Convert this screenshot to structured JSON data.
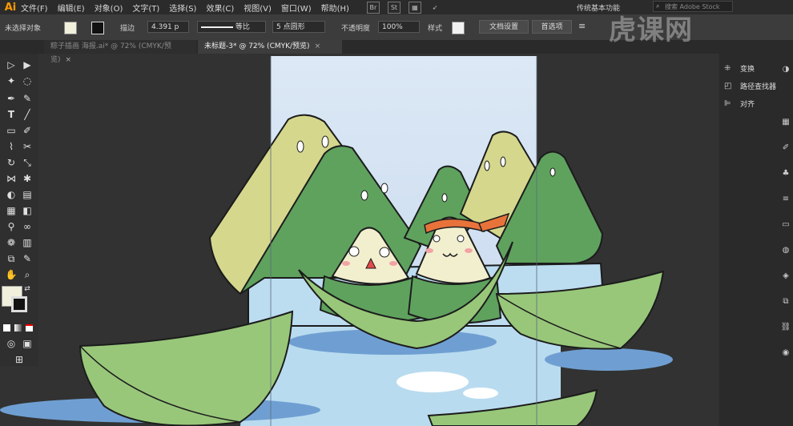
{
  "app": {
    "logo": "Ai"
  },
  "menus": [
    "文件(F)",
    "编辑(E)",
    "对象(O)",
    "文字(T)",
    "选择(S)",
    "效果(C)",
    "视图(V)",
    "窗口(W)",
    "帮助(H)"
  ],
  "menubar_icons": [
    "Br",
    "St"
  ],
  "workspace": {
    "label": "传统基本功能"
  },
  "stock_search": {
    "placeholder": "搜索 Adobe Stock"
  },
  "control_bar": {
    "no_selection": "未选择对象",
    "stroke_label": "描边",
    "stroke_value": "4.391",
    "stroke_unit": "p",
    "profile_label": "等比",
    "brush_value": "5 点圆形",
    "opacity_label": "不透明度",
    "opacity_value": "100%",
    "style_label": "样式",
    "doc_setup_button": "文档设置",
    "preferences_button": "首选项"
  },
  "tabs": [
    {
      "label": "粽子插画 海报.ai* @ 72% (CMYK/预览)",
      "active": false
    },
    {
      "label": "未标题-3* @ 72% (CMYK/预览)",
      "active": true
    }
  ],
  "tab_close": "×",
  "right_panel": {
    "items": [
      {
        "icon": "transform-icon",
        "label": "变换"
      },
      {
        "icon": "pathfinder-icon",
        "label": "路径查找器"
      },
      {
        "icon": "align-icon",
        "label": "对齐"
      }
    ]
  },
  "watermark": {
    "text": "虎课网"
  },
  "colors": {
    "app_bg": "#323232",
    "sky": "#c5d8ee",
    "water": "#b9dbef",
    "water_shadow": "#6f9fd2",
    "leaf": "#98c77a",
    "mountain_dark": "#5fa25e",
    "mountain_light": "#d5d78d",
    "zongzi_face": "#f2efcf",
    "headband": "#e8733a",
    "outline": "#1c1c1c"
  }
}
